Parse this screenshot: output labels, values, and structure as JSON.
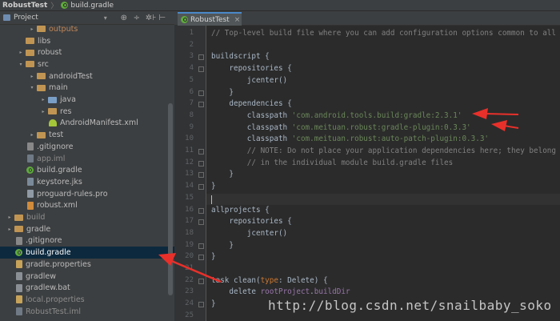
{
  "breadcrumb": {
    "project": "RobustTest",
    "file": "build.gradle"
  },
  "project_pane": {
    "title": "Project",
    "dropdown": "▾",
    "tools": [
      "⊕",
      "÷",
      "✲⊦",
      "⊢"
    ],
    "tree": [
      {
        "label": "outputs",
        "indent": 3,
        "arrow": "▸",
        "icon": "folder",
        "style": "outputs"
      },
      {
        "label": "libs",
        "indent": 2,
        "arrow": "",
        "icon": "folder"
      },
      {
        "label": "robust",
        "indent": 2,
        "arrow": "▸",
        "icon": "folder"
      },
      {
        "label": "src",
        "indent": 2,
        "arrow": "▾",
        "icon": "folder"
      },
      {
        "label": "androidTest",
        "indent": 3,
        "arrow": "▸",
        "icon": "folder"
      },
      {
        "label": "main",
        "indent": 3,
        "arrow": "▾",
        "icon": "folder"
      },
      {
        "label": "java",
        "indent": 4,
        "arrow": "▸",
        "icon": "folder-blue"
      },
      {
        "label": "res",
        "indent": 4,
        "arrow": "▸",
        "icon": "folder"
      },
      {
        "label": "AndroidManifest.xml",
        "indent": 4,
        "arrow": "",
        "icon": "android"
      },
      {
        "label": "test",
        "indent": 3,
        "arrow": "▸",
        "icon": "folder"
      },
      {
        "label": ".gitignore",
        "indent": 2,
        "arrow": "",
        "icon": "gitignore"
      },
      {
        "label": "app.iml",
        "indent": 2,
        "arrow": "",
        "icon": "iml",
        "style": "muted"
      },
      {
        "label": "build.gradle",
        "indent": 2,
        "arrow": "",
        "icon": "gradle"
      },
      {
        "label": "keystore.jks",
        "indent": 2,
        "arrow": "",
        "icon": "key"
      },
      {
        "label": "proguard-rules.pro",
        "indent": 2,
        "arrow": "",
        "icon": "pro"
      },
      {
        "label": "robust.xml",
        "indent": 2,
        "arrow": "",
        "icon": "xml"
      },
      {
        "label": "build",
        "indent": 1,
        "arrow": "▸",
        "icon": "folder",
        "style": "gray"
      },
      {
        "label": "gradle",
        "indent": 1,
        "arrow": "▸",
        "icon": "folder"
      },
      {
        "label": ".gitignore",
        "indent": 1,
        "arrow": "",
        "icon": "gitignore"
      },
      {
        "label": "build.gradle",
        "indent": 1,
        "arrow": "",
        "icon": "gradle",
        "selected": true
      },
      {
        "label": "gradle.properties",
        "indent": 1,
        "arrow": "",
        "icon": "props"
      },
      {
        "label": "gradlew",
        "indent": 1,
        "arrow": "",
        "icon": "file"
      },
      {
        "label": "gradlew.bat",
        "indent": 1,
        "arrow": "",
        "icon": "file"
      },
      {
        "label": "local.properties",
        "indent": 1,
        "arrow": "",
        "icon": "props",
        "style": "muted"
      },
      {
        "label": "RobustTest.iml",
        "indent": 1,
        "arrow": "",
        "icon": "iml",
        "style": "muted"
      }
    ]
  },
  "editor": {
    "tab_label": "RobustTest",
    "tab_close": "×",
    "lines": [
      {
        "n": "1",
        "parts": [
          [
            "c",
            "// Top-level build file where you can add configuration options common to all"
          ]
        ]
      },
      {
        "n": "2",
        "parts": []
      },
      {
        "n": "3",
        "parts": [
          [
            "p",
            "buildscript {"
          ]
        ],
        "fold": true
      },
      {
        "n": "4",
        "parts": [
          [
            "p",
            "    repositories {"
          ]
        ],
        "fold": true
      },
      {
        "n": "5",
        "parts": [
          [
            "p",
            "        jcenter()"
          ]
        ]
      },
      {
        "n": "6",
        "parts": [
          [
            "p",
            "    }"
          ]
        ],
        "fold": true
      },
      {
        "n": "7",
        "parts": [
          [
            "p",
            "    dependencies {"
          ]
        ],
        "fold": true
      },
      {
        "n": "8",
        "parts": [
          [
            "p",
            "        classpath "
          ],
          [
            "s",
            "'com.android.tools.build:gradle:2.3.1'"
          ]
        ]
      },
      {
        "n": "9",
        "parts": [
          [
            "p",
            "        classpath "
          ],
          [
            "s",
            "'com.meituan.robust:gradle-plugin:0.3.3'"
          ]
        ]
      },
      {
        "n": "10",
        "parts": [
          [
            "p",
            "        classpath "
          ],
          [
            "s",
            "'com.meituan.robust:auto-patch-plugin:0.3.3'"
          ]
        ]
      },
      {
        "n": "11",
        "parts": [
          [
            "c",
            "        // NOTE: Do not place your application dependencies here; they belong"
          ]
        ],
        "fold": true
      },
      {
        "n": "12",
        "parts": [
          [
            "c",
            "        // in the individual module build.gradle files"
          ]
        ],
        "fold": true
      },
      {
        "n": "13",
        "parts": [
          [
            "p",
            "    }"
          ]
        ],
        "fold": true
      },
      {
        "n": "14",
        "parts": [
          [
            "p",
            "}"
          ]
        ],
        "fold": true
      },
      {
        "n": "15",
        "parts": [],
        "current": true
      },
      {
        "n": "16",
        "parts": [
          [
            "p",
            "allprojects {"
          ]
        ],
        "fold": true
      },
      {
        "n": "17",
        "parts": [
          [
            "p",
            "    repositories {"
          ]
        ],
        "fold": true
      },
      {
        "n": "18",
        "parts": [
          [
            "p",
            "        jcenter()"
          ]
        ]
      },
      {
        "n": "19",
        "parts": [
          [
            "p",
            "    }"
          ]
        ],
        "fold": true
      },
      {
        "n": "20",
        "parts": [
          [
            "p",
            "}"
          ]
        ],
        "fold": true
      },
      {
        "n": "21",
        "parts": []
      },
      {
        "n": "22",
        "parts": [
          [
            "p",
            "task clean("
          ],
          [
            "k",
            "type"
          ],
          [
            "p",
            ": Delete) {"
          ]
        ],
        "fold": true
      },
      {
        "n": "23",
        "parts": [
          [
            "p",
            "    delete "
          ],
          [
            "v",
            "rootProject"
          ],
          [
            "p",
            "."
          ],
          [
            "v",
            "buildDir"
          ]
        ]
      },
      {
        "n": "24",
        "parts": [
          [
            "p",
            "}"
          ]
        ],
        "fold": true
      },
      {
        "n": "25",
        "parts": []
      }
    ]
  },
  "watermark": "http://blog.csdn.net/snailbaby_soko",
  "colors": {
    "arrow": "#e8302a",
    "selection": "#0d293e",
    "string": "#6a8759",
    "comment": "#808080"
  }
}
